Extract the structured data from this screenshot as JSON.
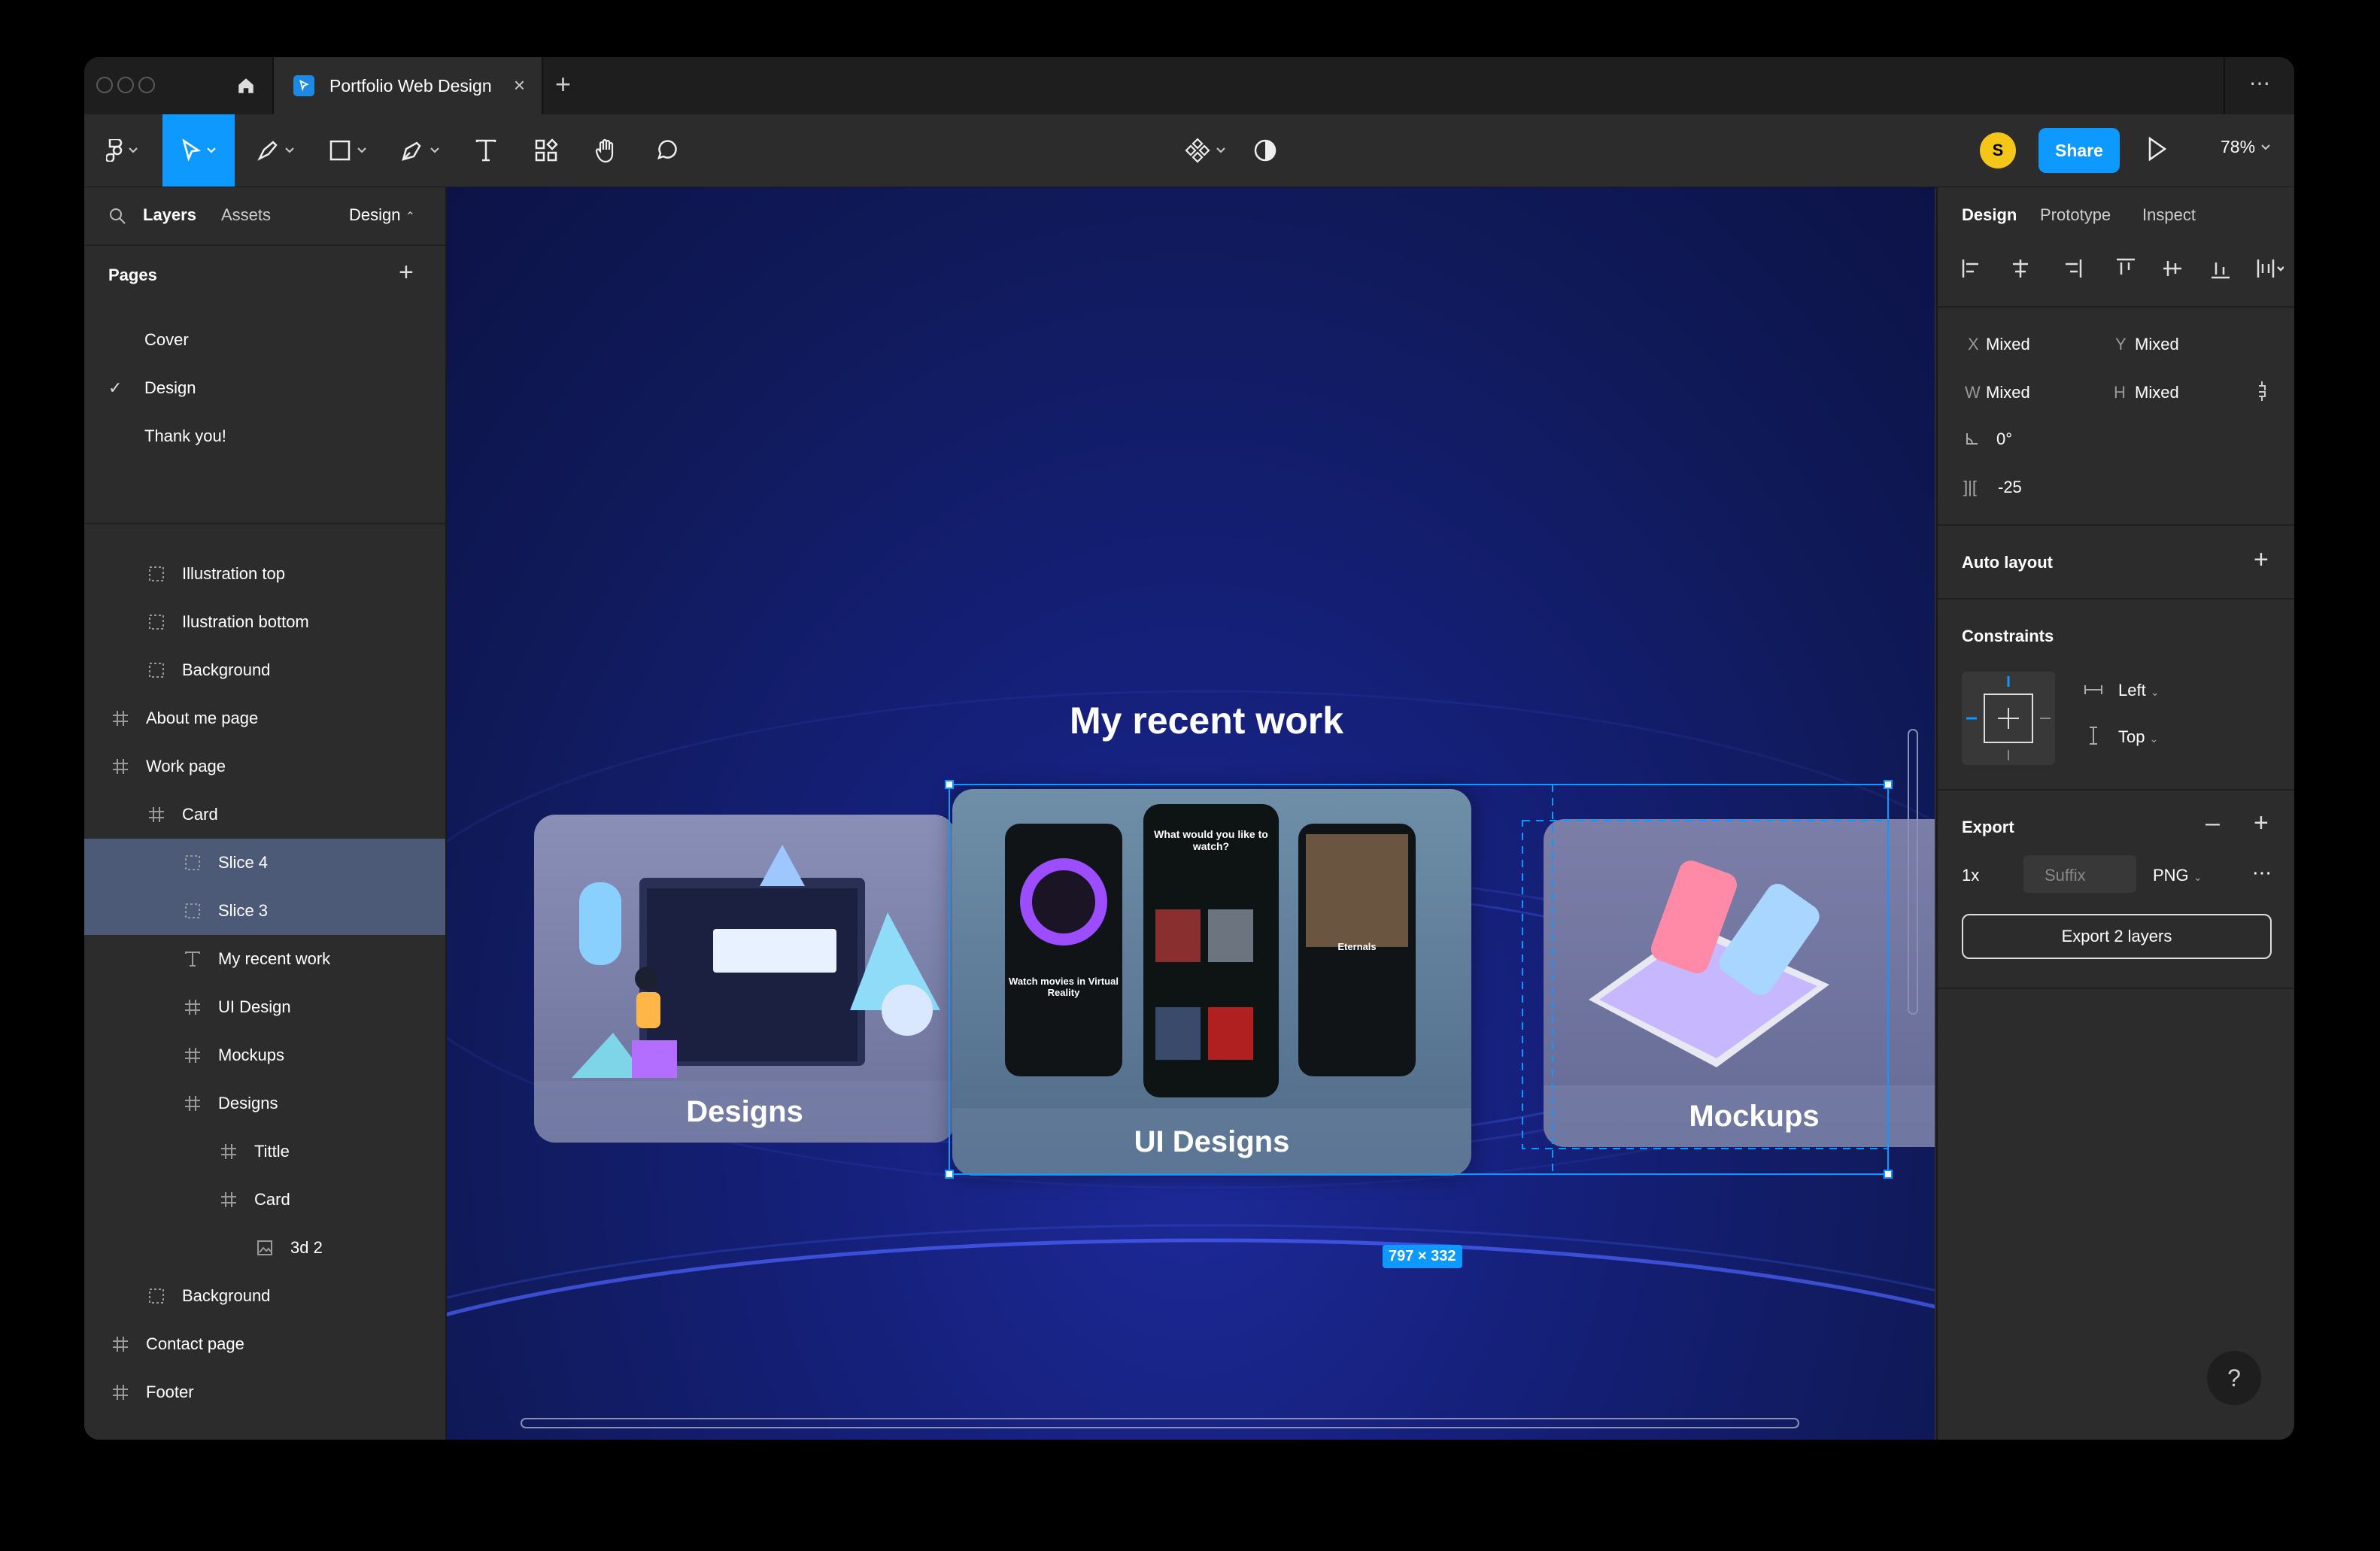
{
  "tabbar": {
    "tab_title": "Portfolio Web Design",
    "tab_close": "×",
    "new_tab": "+",
    "more": "⋯"
  },
  "toolbar": {
    "zoom": "78%",
    "share_label": "Share",
    "avatar_initial": "S",
    "accent_color": "#0d99ff"
  },
  "left_panel": {
    "tabs": [
      "Layers",
      "Assets"
    ],
    "design_dropdown": "Design",
    "pages_header": "Pages",
    "pages": [
      {
        "label": "Cover",
        "selected": false
      },
      {
        "label": "Design",
        "selected": true
      },
      {
        "label": "Thank you!",
        "selected": false
      }
    ],
    "layers": [
      {
        "label": "Illustration top",
        "icon": "slice-icon",
        "indent": 2,
        "selected": false
      },
      {
        "label": "Ilustration bottom",
        "icon": "slice-icon",
        "indent": 2,
        "selected": false
      },
      {
        "label": "Background",
        "icon": "slice-icon",
        "indent": 2,
        "selected": false
      },
      {
        "label": "About me page",
        "icon": "frame-icon",
        "indent": 1,
        "selected": false
      },
      {
        "label": "Work page",
        "icon": "frame-icon",
        "indent": 1,
        "selected": false
      },
      {
        "label": "Card",
        "icon": "frame-icon",
        "indent": 2,
        "selected": false
      },
      {
        "label": "Slice 4",
        "icon": "slice-icon",
        "indent": 3,
        "selected": true
      },
      {
        "label": "Slice 3",
        "icon": "slice-icon",
        "indent": 3,
        "selected": true
      },
      {
        "label": "My recent work",
        "icon": "text-icon",
        "indent": 3,
        "selected": false
      },
      {
        "label": "UI Design",
        "icon": "frame-icon",
        "indent": 3,
        "selected": false
      },
      {
        "label": "Mockups",
        "icon": "frame-icon",
        "indent": 3,
        "selected": false
      },
      {
        "label": "Designs",
        "icon": "frame-icon",
        "indent": 3,
        "selected": false
      },
      {
        "label": "Tittle",
        "icon": "frame-icon",
        "indent": 4,
        "selected": false
      },
      {
        "label": "Card",
        "icon": "frame-icon",
        "indent": 4,
        "selected": false
      },
      {
        "label": "3d 2",
        "icon": "image-icon",
        "indent": 5,
        "selected": false
      },
      {
        "label": "Background",
        "icon": "slice-icon",
        "indent": 2,
        "selected": false
      },
      {
        "label": "Contact page",
        "icon": "frame-icon",
        "indent": 1,
        "selected": false
      },
      {
        "label": "Footer",
        "icon": "frame-icon",
        "indent": 1,
        "selected": false
      }
    ]
  },
  "canvas": {
    "title": "My recent work",
    "cards": [
      {
        "label": "Designs"
      },
      {
        "label": "UI Designs"
      },
      {
        "label": "Mockups"
      }
    ],
    "size_badge": "797 × 332",
    "phone1_text": "Watch movies in Virtual Reality",
    "phone2_text": "What would you like to watch?",
    "phone3_text": "Eternals"
  },
  "right_panel": {
    "tabs": [
      "Design",
      "Prototype",
      "Inspect"
    ],
    "x_label": "X",
    "x_value": "Mixed",
    "y_label": "Y",
    "y_value": "Mixed",
    "w_label": "W",
    "w_value": "Mixed",
    "h_label": "H",
    "h_value": "Mixed",
    "rotation": "0°",
    "spacing": "-25",
    "auto_layout": "Auto layout",
    "constraints": "Constraints",
    "constraint_h": "Left",
    "constraint_v": "Top",
    "export": "Export",
    "export_scale": "1x",
    "export_suffix_placeholder": "Suffix",
    "export_format": "PNG",
    "export_button": "Export 2 layers",
    "help": "?"
  }
}
